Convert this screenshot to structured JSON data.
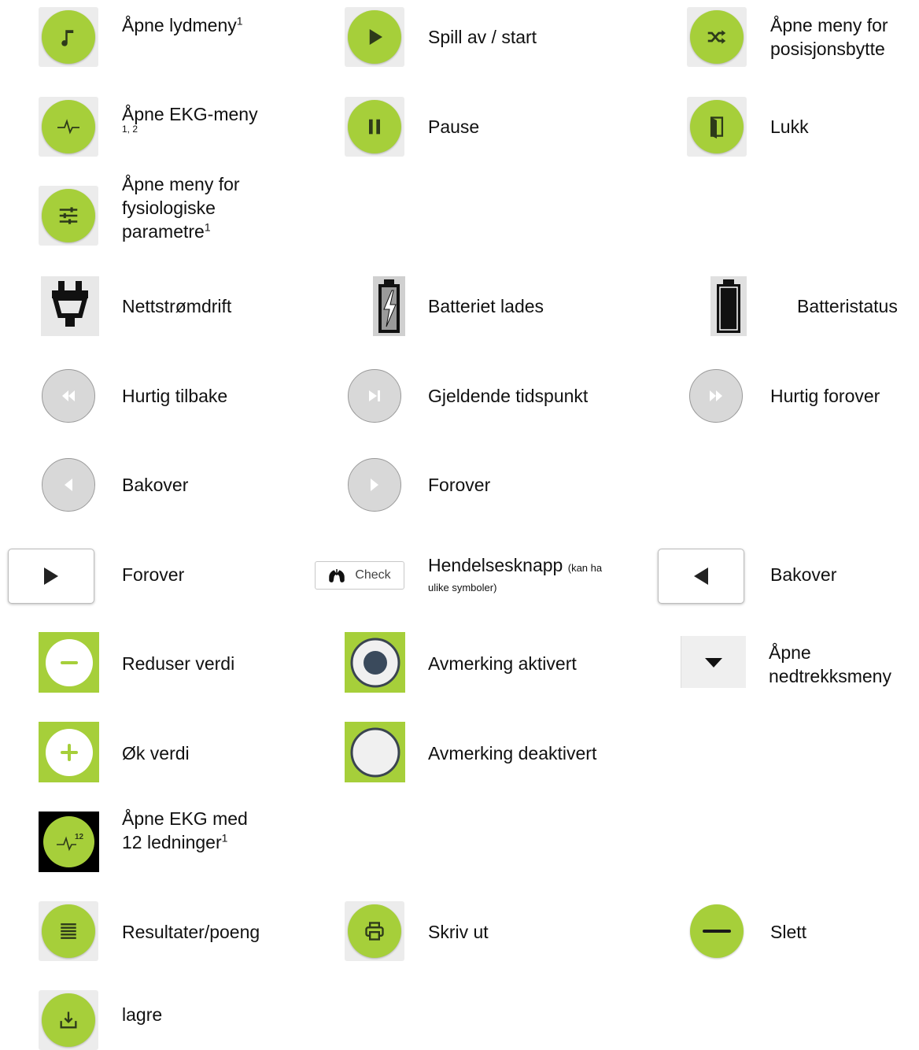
{
  "rows": {
    "r1": {
      "c1": "Åpne lydmeny",
      "c1_sup": "1",
      "c2": "Spill av / start",
      "c3_line1": "Åpne meny for",
      "c3_line2": "posisjonsbytte"
    },
    "r2": {
      "c1": "Åpne EKG-meny",
      "c1_sub": "1, 2",
      "c2": "Pause",
      "c3": "Lukk"
    },
    "r3": {
      "c1_line1": "Åpne meny for",
      "c1_line2": "fysiologiske",
      "c1_line3": "parametre",
      "c1_sup": "1"
    },
    "r4": {
      "c1": "Nettstrømdrift",
      "c2": "Batteriet lades",
      "c3": "Batteristatus"
    },
    "r5": {
      "c1": "Hurtig tilbake",
      "c2": "Gjeldende tidspunkt",
      "c3": "Hurtig forover"
    },
    "r6": {
      "c1": "Bakover",
      "c2": "Forover"
    },
    "r7": {
      "c1": "Forover",
      "c2_btn": "Check",
      "c2": "Hendelsesknapp",
      "c2_small_line1": "(kan ha",
      "c2_small_line2": "ulike symboler)",
      "c3": "Bakover"
    },
    "r8": {
      "c1": "Reduser verdi",
      "c2": "Avmerking aktivert",
      "c3_line1": "Åpne",
      "c3_line2": "nedtrekksmeny"
    },
    "r9": {
      "c1": "Øk verdi",
      "c2": "Avmerking deaktivert"
    },
    "r10": {
      "c1_line1": "Åpne EKG med",
      "c1_line2": "12 ledninger",
      "c1_sup": "1",
      "ecg12_badge": "12"
    },
    "r11": {
      "c1": "Resultater/poeng",
      "c2": "Skriv ut",
      "c3": "Slett"
    },
    "r12": {
      "c1": "lagre"
    }
  },
  "colors": {
    "green": "#a6cf3a",
    "icon_dark": "#2d3a1a",
    "gray": "#d8d8d8"
  },
  "icons": [
    "music-note-icon",
    "play-icon",
    "shuffle-icon",
    "ecg-icon",
    "pause-icon",
    "door-close-icon",
    "sliders-icon",
    "plug-icon",
    "battery-charging-icon",
    "battery-full-icon",
    "rewind-icon",
    "skip-to-current-icon",
    "fast-forward-icon",
    "back-icon",
    "forward-icon",
    "play-arrow-icon",
    "lungs-icon",
    "back-arrow-icon",
    "minus-icon",
    "radio-checked-icon",
    "dropdown-arrow-icon",
    "plus-icon",
    "radio-unchecked-icon",
    "ecg12-icon",
    "list-icon",
    "print-icon",
    "delete-icon",
    "save-icon"
  ]
}
